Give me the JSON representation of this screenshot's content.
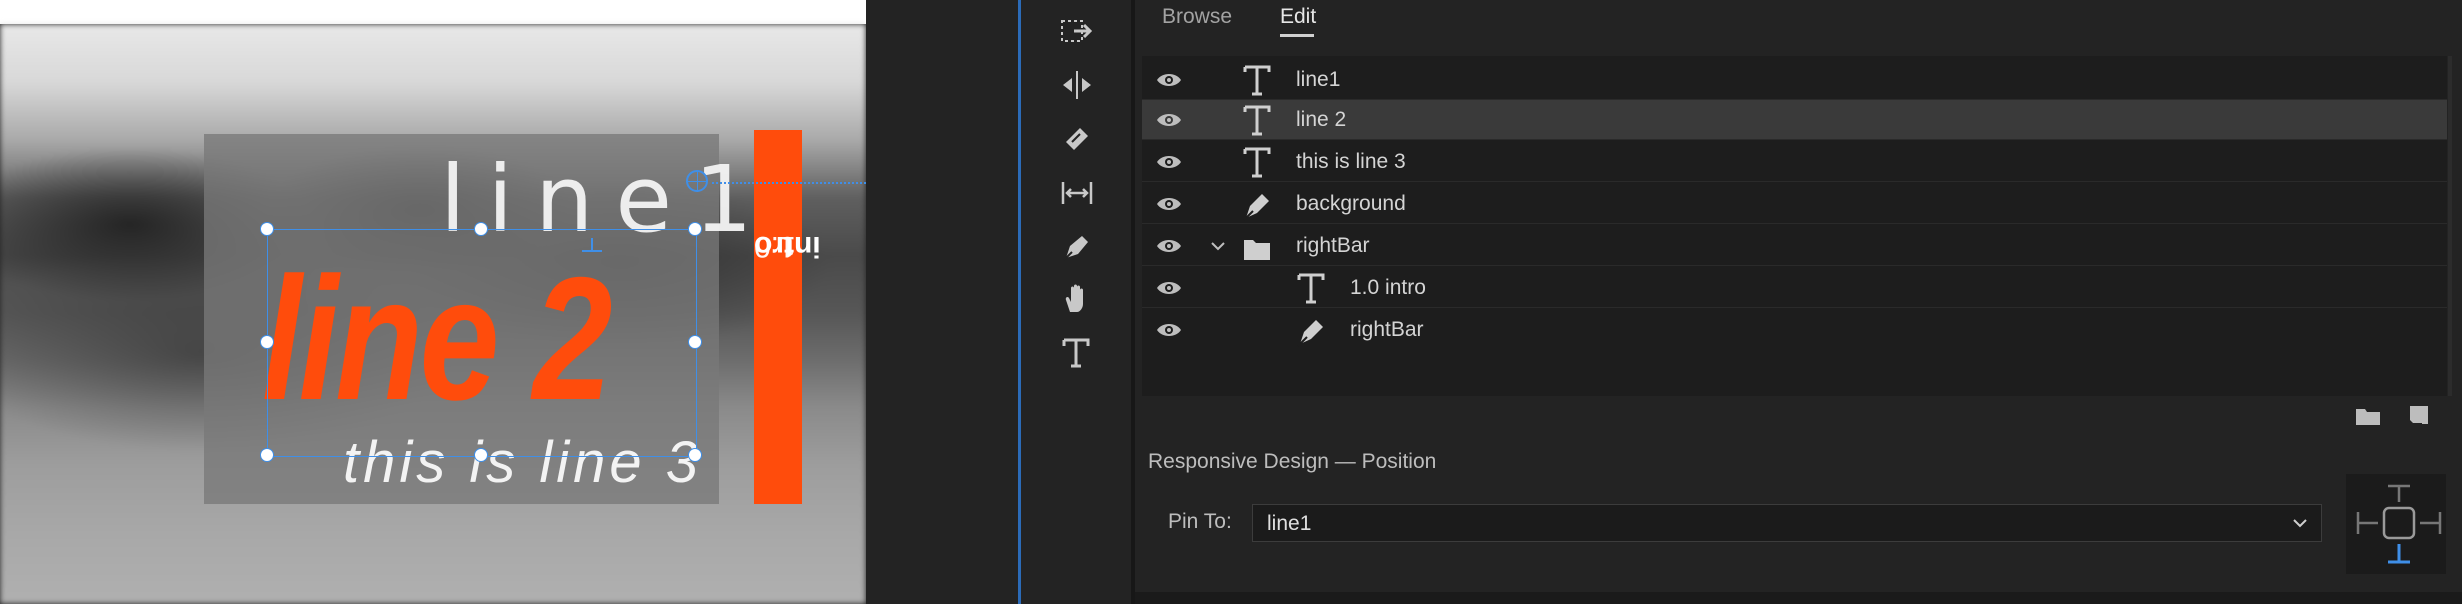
{
  "monitor": {
    "line1": "line1",
    "line2": "line 2",
    "line3": "this is line 3",
    "bar_num": "1.0",
    "bar_word": "intro",
    "accent": "#ff4c0c",
    "selection_color": "#3f8fe8"
  },
  "tools": [
    {
      "name": "track-select-icon"
    },
    {
      "name": "ripple-edit-icon"
    },
    {
      "name": "razor-icon"
    },
    {
      "name": "slip-icon"
    },
    {
      "name": "pen-icon"
    },
    {
      "name": "hand-icon"
    },
    {
      "name": "type-icon"
    }
  ],
  "tabs": [
    {
      "label": "Browse"
    },
    {
      "label": "Edit",
      "active": true
    }
  ],
  "layers": [
    {
      "label": "line1",
      "icon": "text-icon"
    },
    {
      "label": "line 2",
      "icon": "text-icon",
      "selected": true
    },
    {
      "label": "this is line 3",
      "icon": "text-icon"
    },
    {
      "label": "background",
      "icon": "pen-icon"
    },
    {
      "label": "rightBar",
      "icon": "folder-icon",
      "expanded": true
    },
    {
      "label": "1.0 intro",
      "icon": "text-icon"
    },
    {
      "label": "rightBar",
      "icon": "pen-icon"
    }
  ],
  "responsive": {
    "title": "Responsive Design — Position",
    "pin_label": "Pin To:",
    "pin_value": "line1"
  }
}
